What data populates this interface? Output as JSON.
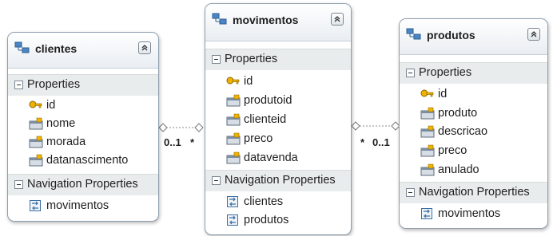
{
  "entities": {
    "clientes": {
      "title": "clientes",
      "properties_label": "Properties",
      "properties": [
        "id",
        "nome",
        "morada",
        "datanascimento"
      ],
      "nav_label": "Navigation Properties",
      "nav_properties": [
        "movimentos"
      ]
    },
    "movimentos": {
      "title": "movimentos",
      "properties_label": "Properties",
      "properties": [
        "id",
        "produtoid",
        "clienteid",
        "preco",
        "datavenda"
      ],
      "nav_label": "Navigation Properties",
      "nav_properties": [
        "clientes",
        "produtos"
      ]
    },
    "produtos": {
      "title": "produtos",
      "properties_label": "Properties",
      "properties": [
        "id",
        "produto",
        "descricao",
        "preco",
        "anulado"
      ],
      "nav_label": "Navigation Properties",
      "nav_properties": [
        "movimentos"
      ]
    }
  },
  "associations": {
    "clientes_movimentos": {
      "from_multiplicity": "0..1",
      "to_multiplicity": "*"
    },
    "movimentos_produtos": {
      "from_multiplicity": "*",
      "to_multiplicity": "0..1"
    }
  },
  "icons": {
    "entity": "entity-icon",
    "key_property": "key-property-icon",
    "property": "property-icon",
    "navigation_property": "navigation-property-icon",
    "collapse": "collapse-icon"
  },
  "colors": {
    "border": "#8f9fae",
    "section_bg": "#e9ecec",
    "property_icon": "#f0b400",
    "navigation_icon": "#3a6ea5",
    "connector": "#8a8a8a"
  }
}
